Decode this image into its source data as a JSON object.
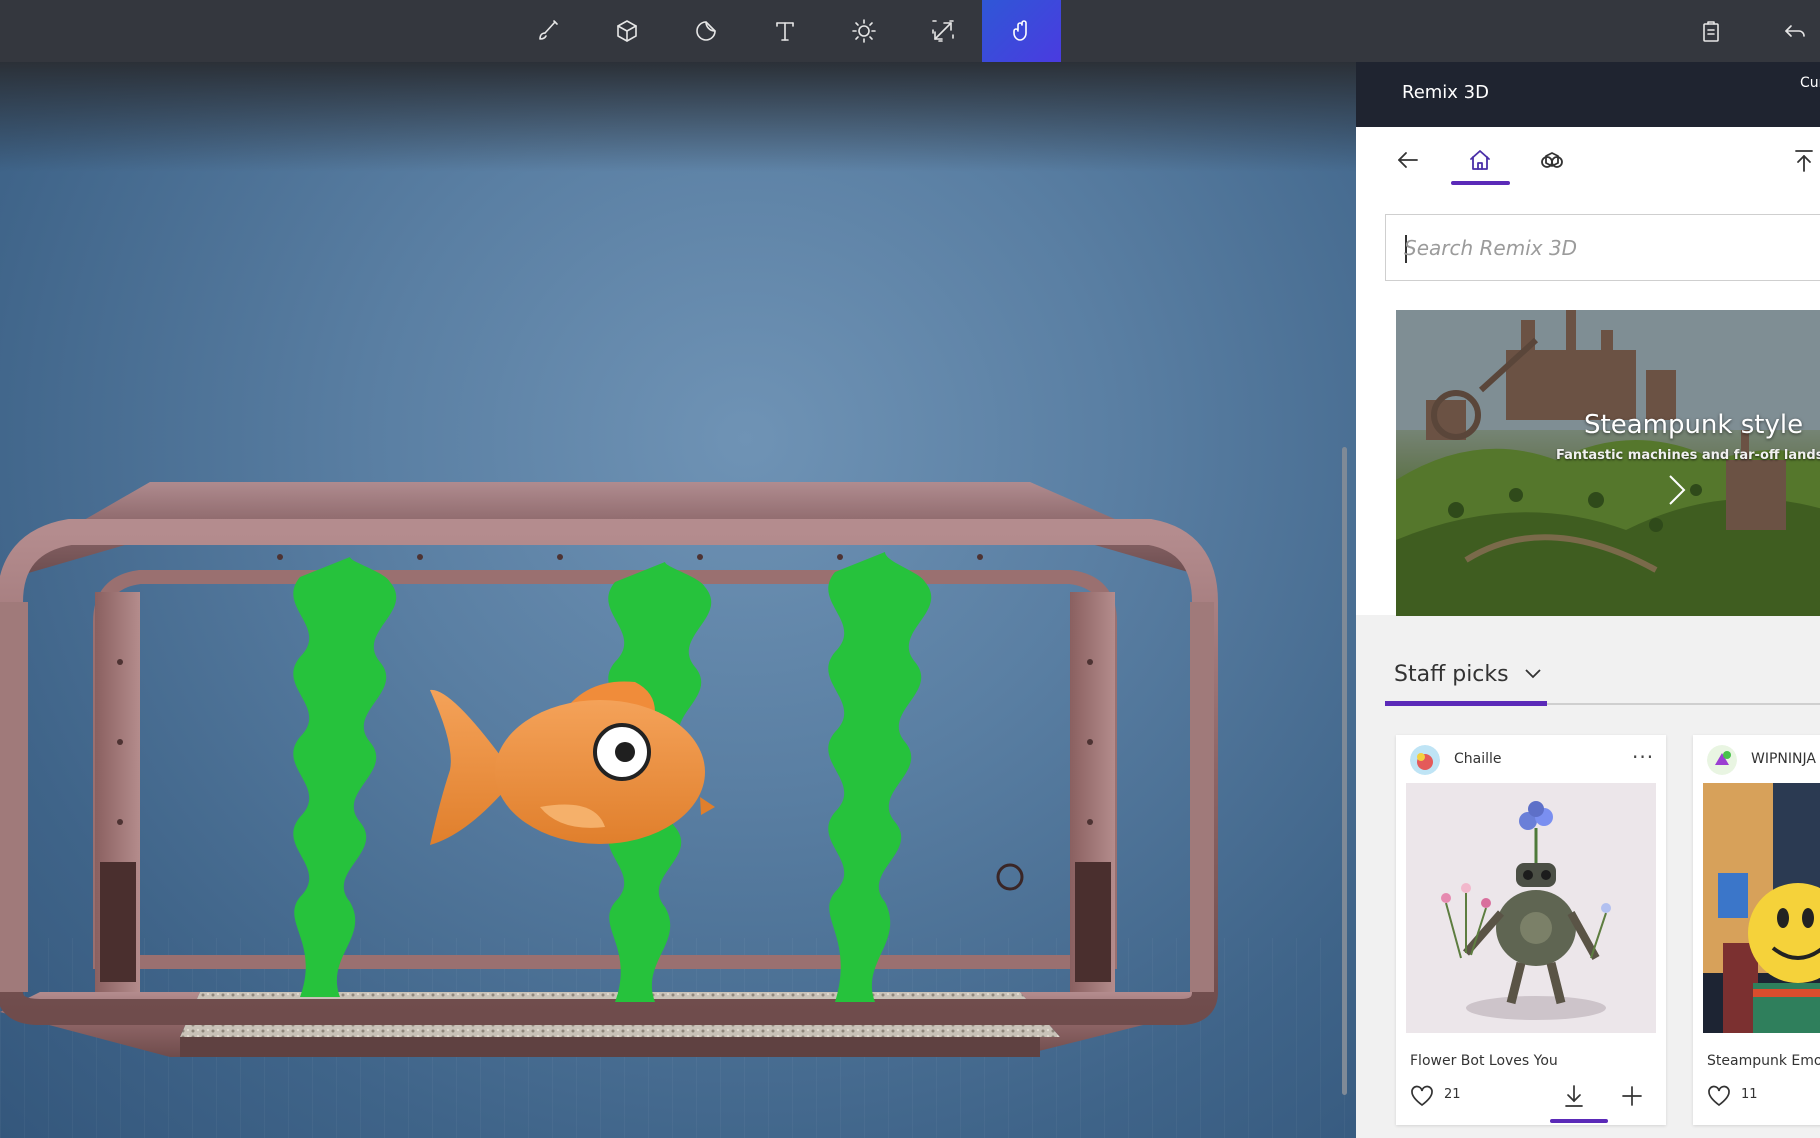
{
  "toolbar": {
    "tools": [
      {
        "name": "brush-icon",
        "label": "Art tools"
      },
      {
        "name": "cube-icon",
        "label": "3D shapes"
      },
      {
        "name": "sticker-icon",
        "label": "Stickers"
      },
      {
        "name": "text-icon",
        "label": "Text"
      },
      {
        "name": "sun-icon",
        "label": "Effects"
      },
      {
        "name": "resize-icon",
        "label": "Canvas"
      },
      {
        "name": "remix-icon",
        "label": "Remix 3D"
      }
    ],
    "active_tool": "remix-icon",
    "accent_color": "#3f4fe0"
  },
  "panel": {
    "title": "Remix 3D",
    "cut_label": "Cur",
    "search": {
      "placeholder": "Search Remix 3D",
      "value": ""
    },
    "hero": {
      "title": "Steampunk style",
      "subtitle": "Fantastic machines and far-off lands"
    },
    "section": {
      "label": "Staff picks"
    },
    "cards": [
      {
        "author": "Chaille",
        "name": "Flower Bot Loves You",
        "likes": "21"
      },
      {
        "author": "WIPNINJA",
        "name": "Steampunk Emoji",
        "likes": "11"
      }
    ],
    "accent_color": "#5b2ab8"
  }
}
